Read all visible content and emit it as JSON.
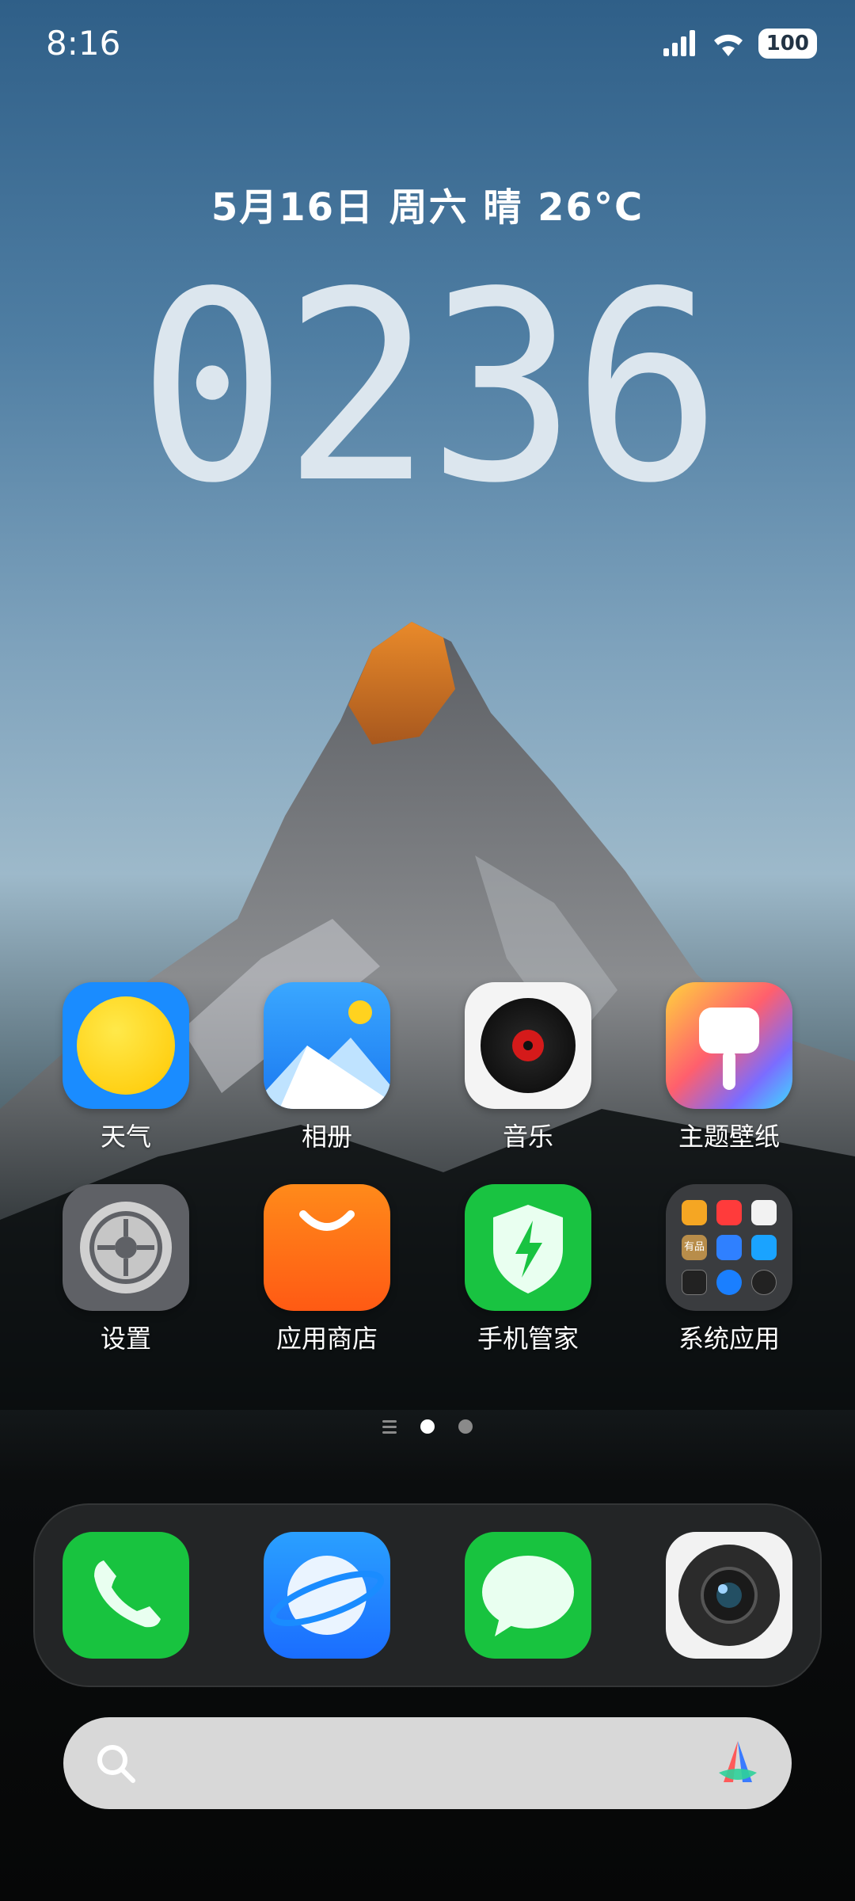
{
  "status_bar": {
    "time": "8:16",
    "battery": "100",
    "icons": [
      "signal-icon",
      "wifi-icon",
      "battery-icon"
    ]
  },
  "clock_widget": {
    "date_weather": "5月16日 周六 晴 26°C",
    "time": "0236"
  },
  "apps": [
    {
      "label": "天气",
      "icon": "weather-icon"
    },
    {
      "label": "相册",
      "icon": "gallery-icon"
    },
    {
      "label": "音乐",
      "icon": "music-icon"
    },
    {
      "label": "主题壁纸",
      "icon": "themes-icon"
    },
    {
      "label": "设置",
      "icon": "settings-icon"
    },
    {
      "label": "应用商店",
      "icon": "app-store-icon"
    },
    {
      "label": "手机管家",
      "icon": "security-icon"
    },
    {
      "label": "系统应用",
      "icon": "folder-icon"
    }
  ],
  "folder_mini_label": "有品",
  "dock": [
    "phone-icon",
    "browser-icon",
    "messages-icon",
    "camera-icon"
  ],
  "search_bar": {
    "icons": [
      "search-icon",
      "assistant-icon"
    ]
  },
  "colors": {
    "accent_green": "#1fc84a",
    "accent_blue": "#1a8cff",
    "accent_orange": "#ff6a1a"
  }
}
